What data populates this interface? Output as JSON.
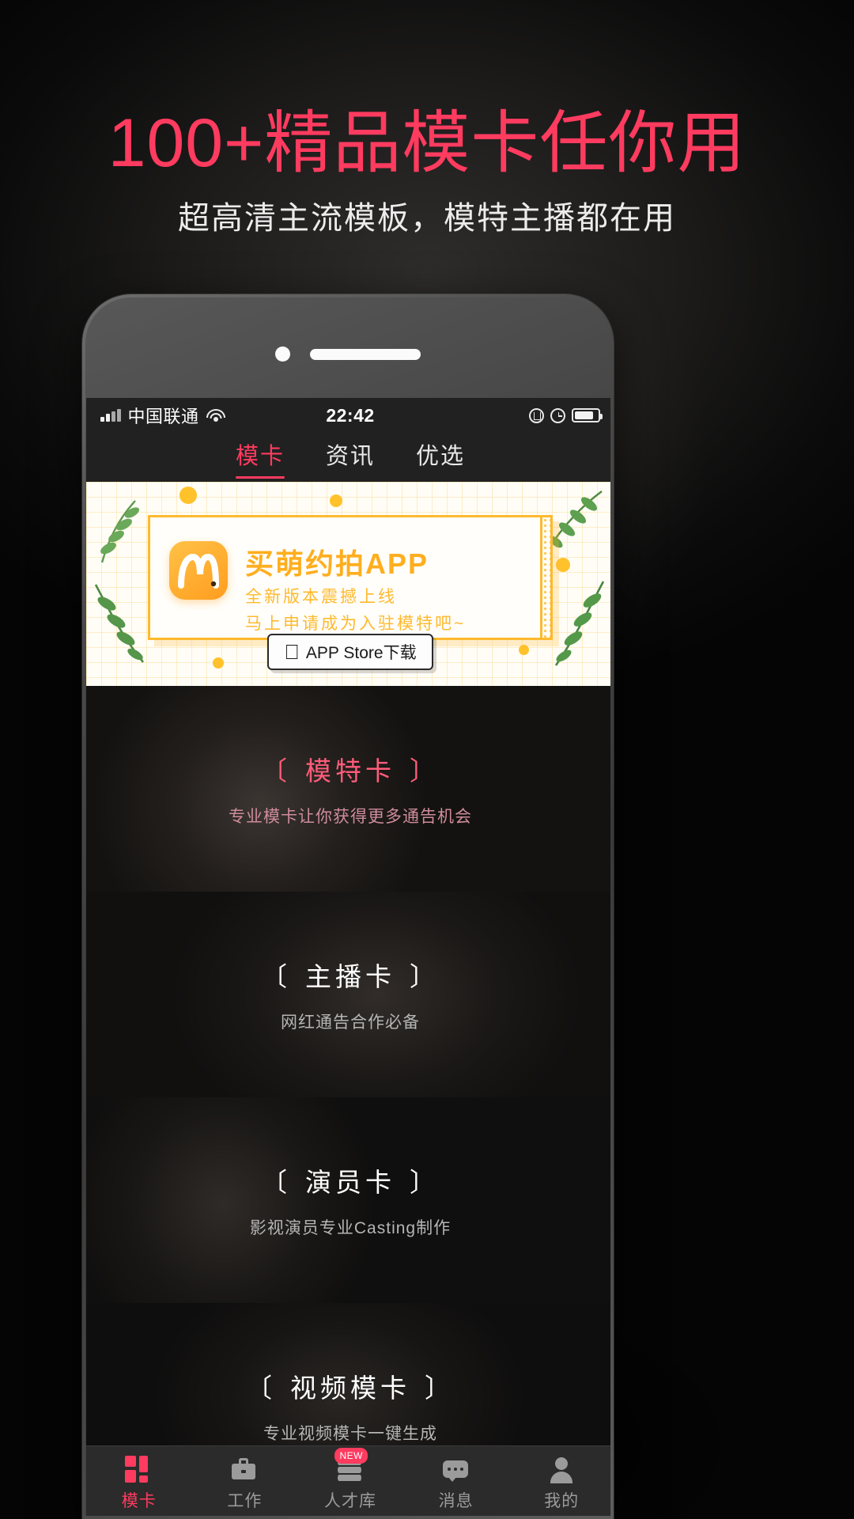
{
  "promo": {
    "headline": "100+精品模卡任你用",
    "subheadline": "超高清主流模板，模特主播都在用",
    "headline_color": "#ff3b5f",
    "subheadline_color": "#ececec"
  },
  "phone": {
    "status_bar": {
      "signal_icon": "signal-bars-icon",
      "carrier": "中国联通",
      "wifi_icon": "wifi-icon",
      "time": "22:42",
      "lock_icon": "rotation-lock-icon",
      "alarm_icon": "alarm-clock-icon",
      "battery_icon": "battery-icon",
      "battery_level": "72%"
    },
    "top_nav": {
      "tabs": [
        {
          "label": "模卡",
          "active": true
        },
        {
          "label": "资讯",
          "active": false
        },
        {
          "label": "优选",
          "active": false
        }
      ],
      "active_color": "#ff3b5f"
    },
    "banner": {
      "logo_icon": "m-app-logo-icon",
      "title": "买萌约拍APP",
      "sub_line_1": "全新版本震撼上线",
      "sub_line_2": "马上申请成为入驻模特吧~",
      "download_button": {
        "apple_icon": "apple-icon",
        "label": "APP Store下载"
      },
      "accent_color": "#ffb92e",
      "background_color": "#fffdf6"
    },
    "categories": [
      {
        "bracket_left": "〔",
        "title": "模特卡",
        "bracket_right": "〕",
        "subtitle": "专业模卡让你获得更多通告机会",
        "highlight": true
      },
      {
        "bracket_left": "〔",
        "title": "主播卡",
        "bracket_right": "〕",
        "subtitle": "网红通告合作必备",
        "highlight": false
      },
      {
        "bracket_left": "〔",
        "title": "演员卡",
        "bracket_right": "〕",
        "subtitle": "影视演员专业Casting制作",
        "highlight": false
      },
      {
        "bracket_left": "〔",
        "title": "视频模卡",
        "bracket_right": "〕",
        "subtitle": "专业视频模卡一键生成",
        "highlight": false
      }
    ],
    "tab_bar": {
      "items": [
        {
          "label": "模卡",
          "icon": "grid-icon",
          "active": true,
          "badge": ""
        },
        {
          "label": "工作",
          "icon": "briefcase-icon",
          "active": false,
          "badge": ""
        },
        {
          "label": "人才库",
          "icon": "layers-icon",
          "active": false,
          "badge": "NEW"
        },
        {
          "label": "消息",
          "icon": "chat-icon",
          "active": false,
          "badge": ""
        },
        {
          "label": "我的",
          "icon": "person-icon",
          "active": false,
          "badge": ""
        }
      ],
      "active_color": "#ff3b5f",
      "inactive_color": "#9b9b9b"
    }
  }
}
